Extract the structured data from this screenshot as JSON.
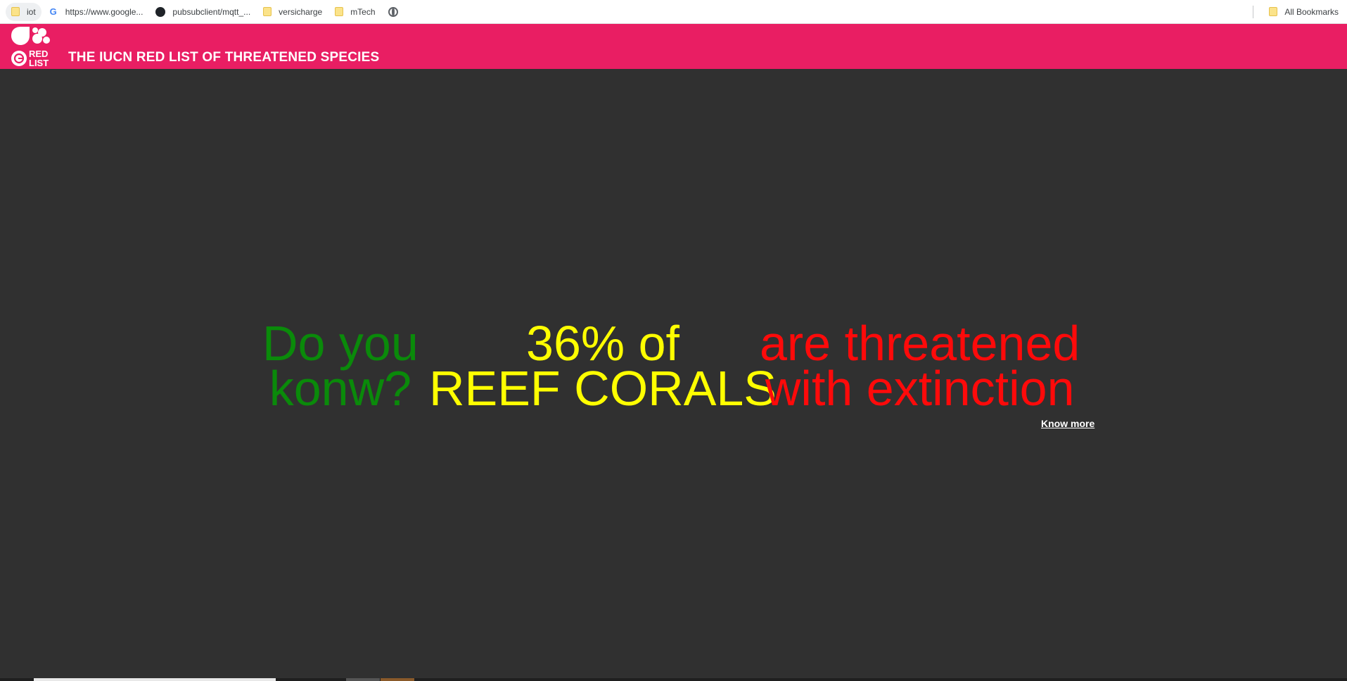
{
  "bookmarks_bar": {
    "items": [
      {
        "label": "iot",
        "icon": "folder-icon"
      },
      {
        "label": "https://www.google...",
        "icon": "google-icon"
      },
      {
        "label": "pubsubclient/mqtt_...",
        "icon": "github-icon"
      },
      {
        "label": "versicharge",
        "icon": "folder-icon"
      },
      {
        "label": "mTech",
        "icon": "folder-icon"
      },
      {
        "label": "",
        "icon": "globe-icon"
      }
    ],
    "all_bookmarks": {
      "label": "All Bookmarks",
      "icon": "folder-icon"
    }
  },
  "header": {
    "title": "THE IUCN RED LIST OF THREATENED SPECIES",
    "logo_text": "RED LIST",
    "background_color": "#e91e63"
  },
  "hero": {
    "left": {
      "line1": "Do you",
      "line2": "konw?",
      "color": "#0a8a0a"
    },
    "center": {
      "line1": "36% of",
      "line2": "REEF CORALS",
      "color": "#ffff00"
    },
    "right": {
      "line1": "are threatened",
      "line2": "with extinction",
      "color": "#ff0a0a"
    },
    "link_label": "Know more"
  },
  "page": {
    "background_color": "#303030"
  }
}
